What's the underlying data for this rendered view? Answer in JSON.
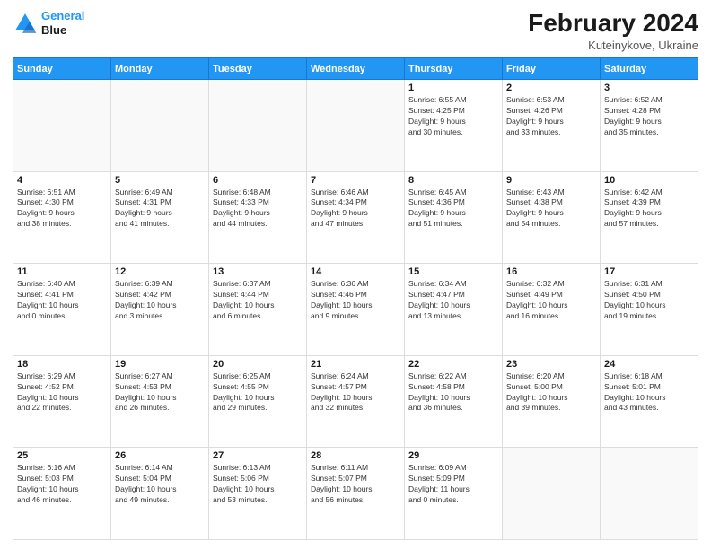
{
  "header": {
    "logo_line1": "General",
    "logo_line2": "Blue",
    "title": "February 2024",
    "location": "Kuteinykove, Ukraine"
  },
  "days_of_week": [
    "Sunday",
    "Monday",
    "Tuesday",
    "Wednesday",
    "Thursday",
    "Friday",
    "Saturday"
  ],
  "weeks": [
    [
      {
        "day": "",
        "info": ""
      },
      {
        "day": "",
        "info": ""
      },
      {
        "day": "",
        "info": ""
      },
      {
        "day": "",
        "info": ""
      },
      {
        "day": "1",
        "info": "Sunrise: 6:55 AM\nSunset: 4:25 PM\nDaylight: 9 hours\nand 30 minutes."
      },
      {
        "day": "2",
        "info": "Sunrise: 6:53 AM\nSunset: 4:26 PM\nDaylight: 9 hours\nand 33 minutes."
      },
      {
        "day": "3",
        "info": "Sunrise: 6:52 AM\nSunset: 4:28 PM\nDaylight: 9 hours\nand 35 minutes."
      }
    ],
    [
      {
        "day": "4",
        "info": "Sunrise: 6:51 AM\nSunset: 4:30 PM\nDaylight: 9 hours\nand 38 minutes."
      },
      {
        "day": "5",
        "info": "Sunrise: 6:49 AM\nSunset: 4:31 PM\nDaylight: 9 hours\nand 41 minutes."
      },
      {
        "day": "6",
        "info": "Sunrise: 6:48 AM\nSunset: 4:33 PM\nDaylight: 9 hours\nand 44 minutes."
      },
      {
        "day": "7",
        "info": "Sunrise: 6:46 AM\nSunset: 4:34 PM\nDaylight: 9 hours\nand 47 minutes."
      },
      {
        "day": "8",
        "info": "Sunrise: 6:45 AM\nSunset: 4:36 PM\nDaylight: 9 hours\nand 51 minutes."
      },
      {
        "day": "9",
        "info": "Sunrise: 6:43 AM\nSunset: 4:38 PM\nDaylight: 9 hours\nand 54 minutes."
      },
      {
        "day": "10",
        "info": "Sunrise: 6:42 AM\nSunset: 4:39 PM\nDaylight: 9 hours\nand 57 minutes."
      }
    ],
    [
      {
        "day": "11",
        "info": "Sunrise: 6:40 AM\nSunset: 4:41 PM\nDaylight: 10 hours\nand 0 minutes."
      },
      {
        "day": "12",
        "info": "Sunrise: 6:39 AM\nSunset: 4:42 PM\nDaylight: 10 hours\nand 3 minutes."
      },
      {
        "day": "13",
        "info": "Sunrise: 6:37 AM\nSunset: 4:44 PM\nDaylight: 10 hours\nand 6 minutes."
      },
      {
        "day": "14",
        "info": "Sunrise: 6:36 AM\nSunset: 4:46 PM\nDaylight: 10 hours\nand 9 minutes."
      },
      {
        "day": "15",
        "info": "Sunrise: 6:34 AM\nSunset: 4:47 PM\nDaylight: 10 hours\nand 13 minutes."
      },
      {
        "day": "16",
        "info": "Sunrise: 6:32 AM\nSunset: 4:49 PM\nDaylight: 10 hours\nand 16 minutes."
      },
      {
        "day": "17",
        "info": "Sunrise: 6:31 AM\nSunset: 4:50 PM\nDaylight: 10 hours\nand 19 minutes."
      }
    ],
    [
      {
        "day": "18",
        "info": "Sunrise: 6:29 AM\nSunset: 4:52 PM\nDaylight: 10 hours\nand 22 minutes."
      },
      {
        "day": "19",
        "info": "Sunrise: 6:27 AM\nSunset: 4:53 PM\nDaylight: 10 hours\nand 26 minutes."
      },
      {
        "day": "20",
        "info": "Sunrise: 6:25 AM\nSunset: 4:55 PM\nDaylight: 10 hours\nand 29 minutes."
      },
      {
        "day": "21",
        "info": "Sunrise: 6:24 AM\nSunset: 4:57 PM\nDaylight: 10 hours\nand 32 minutes."
      },
      {
        "day": "22",
        "info": "Sunrise: 6:22 AM\nSunset: 4:58 PM\nDaylight: 10 hours\nand 36 minutes."
      },
      {
        "day": "23",
        "info": "Sunrise: 6:20 AM\nSunset: 5:00 PM\nDaylight: 10 hours\nand 39 minutes."
      },
      {
        "day": "24",
        "info": "Sunrise: 6:18 AM\nSunset: 5:01 PM\nDaylight: 10 hours\nand 43 minutes."
      }
    ],
    [
      {
        "day": "25",
        "info": "Sunrise: 6:16 AM\nSunset: 5:03 PM\nDaylight: 10 hours\nand 46 minutes."
      },
      {
        "day": "26",
        "info": "Sunrise: 6:14 AM\nSunset: 5:04 PM\nDaylight: 10 hours\nand 49 minutes."
      },
      {
        "day": "27",
        "info": "Sunrise: 6:13 AM\nSunset: 5:06 PM\nDaylight: 10 hours\nand 53 minutes."
      },
      {
        "day": "28",
        "info": "Sunrise: 6:11 AM\nSunset: 5:07 PM\nDaylight: 10 hours\nand 56 minutes."
      },
      {
        "day": "29",
        "info": "Sunrise: 6:09 AM\nSunset: 5:09 PM\nDaylight: 11 hours\nand 0 minutes."
      },
      {
        "day": "",
        "info": ""
      },
      {
        "day": "",
        "info": ""
      }
    ]
  ]
}
